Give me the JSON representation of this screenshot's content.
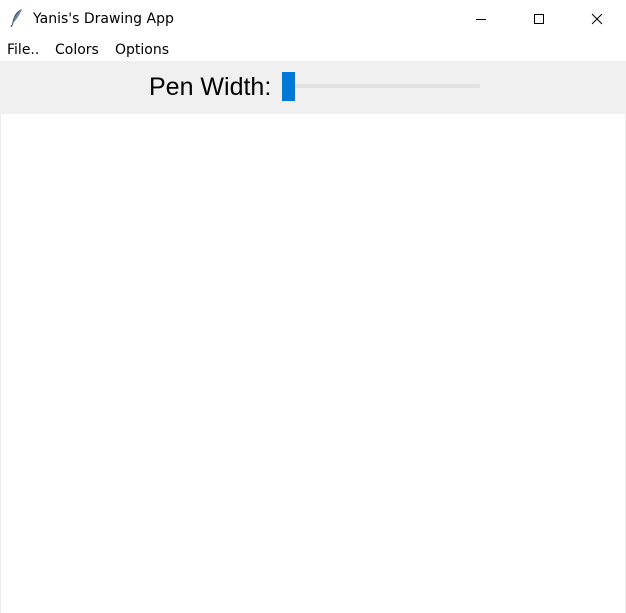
{
  "window": {
    "title": "Yanis's Drawing App",
    "icon": "feather-icon",
    "controls": [
      "minimize-icon",
      "maximize-icon",
      "close-icon"
    ]
  },
  "menubar": {
    "items": [
      {
        "label": "File.."
      },
      {
        "label": "Colors"
      },
      {
        "label": "Options"
      }
    ]
  },
  "toolbar": {
    "pen_width_label": "Pen Width:",
    "pen_width": {
      "value": 1,
      "min": 1,
      "max": 100
    }
  },
  "colors": {
    "accent": "#0078d7",
    "toolbar_bg": "#f0f0f0",
    "canvas_bg": "#ffffff"
  }
}
